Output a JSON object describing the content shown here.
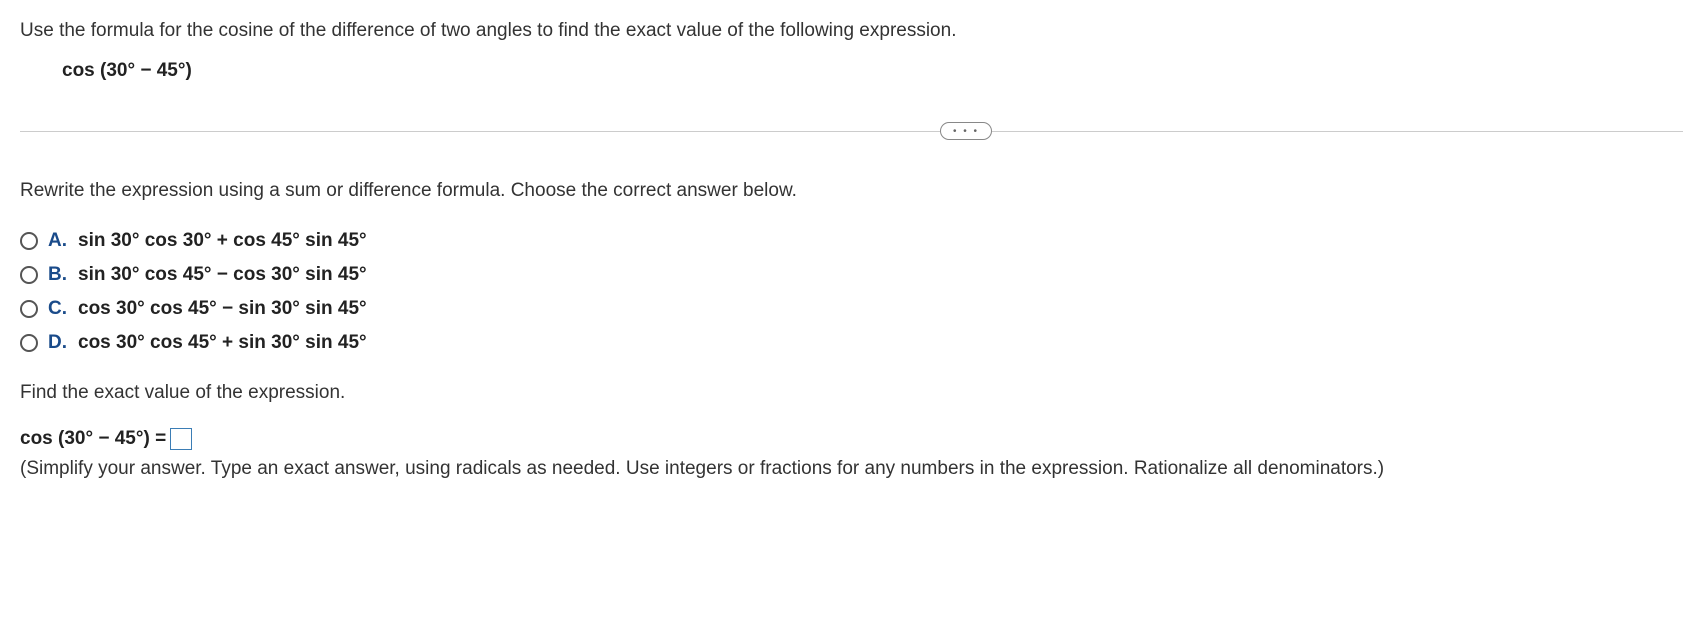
{
  "prompt": "Use the formula for the cosine of the difference of two angles to find the exact value of the following expression.",
  "main_expr_prefix": "cos ",
  "main_expr_body": "(30° − 45°)",
  "ellipsis": "• • •",
  "sub_prompt": "Rewrite the expression using a sum or difference formula. Choose the correct answer below.",
  "options": {
    "A": {
      "letter": "A.",
      "text": "sin 30° cos 30° + cos 45° sin 45°"
    },
    "B": {
      "letter": "B.",
      "text": "sin 30° cos 45° − cos 30° sin 45°"
    },
    "C": {
      "letter": "C.",
      "text": "cos 30° cos 45° − sin 30° sin 45°"
    },
    "D": {
      "letter": "D.",
      "text": "cos 30° cos 45° + sin 30° sin 45°"
    }
  },
  "find_prompt": "Find the exact value of the expression.",
  "answer_expr_prefix": "cos ",
  "answer_expr_body": "(30° − 45°) = ",
  "hint": "(Simplify your answer. Type an exact answer, using radicals as needed. Use integers or fractions for any numbers in the expression. Rationalize all denominators.)"
}
